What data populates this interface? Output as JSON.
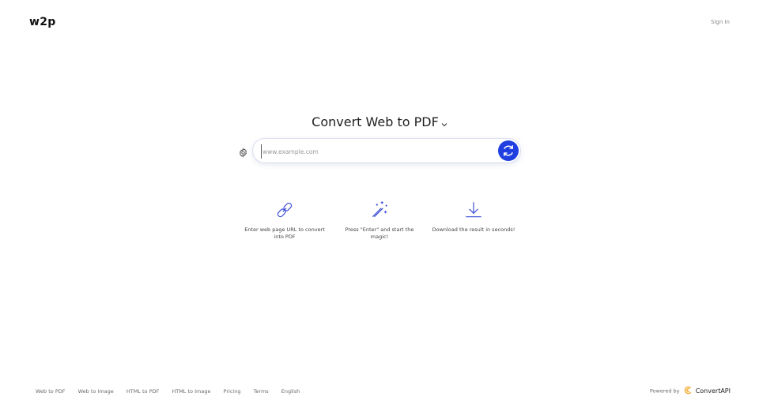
{
  "header": {
    "logo": "w2p",
    "sign_in": "Sign In"
  },
  "main": {
    "title": "Convert Web to PDF",
    "url_placeholder": "www.example.com",
    "steps": [
      {
        "icon": "link-icon",
        "text": "Enter web page URL to convert into PDF"
      },
      {
        "icon": "magic-wand-icon",
        "text": "Press \"Enter\" and start the magic!"
      },
      {
        "icon": "download-icon",
        "text": "Download the result in seconds!"
      }
    ]
  },
  "footer": {
    "links": [
      "Web to PDF",
      "Web to Image",
      "HTML to PDF",
      "HTML to Image",
      "Pricing",
      "Terms",
      "English"
    ],
    "powered_by": "Powered by",
    "brand": "ConvertAPI"
  },
  "colors": {
    "accent": "#1f3fe0",
    "icon": "#3d4fd6",
    "brand_icon": "#f5a623"
  }
}
